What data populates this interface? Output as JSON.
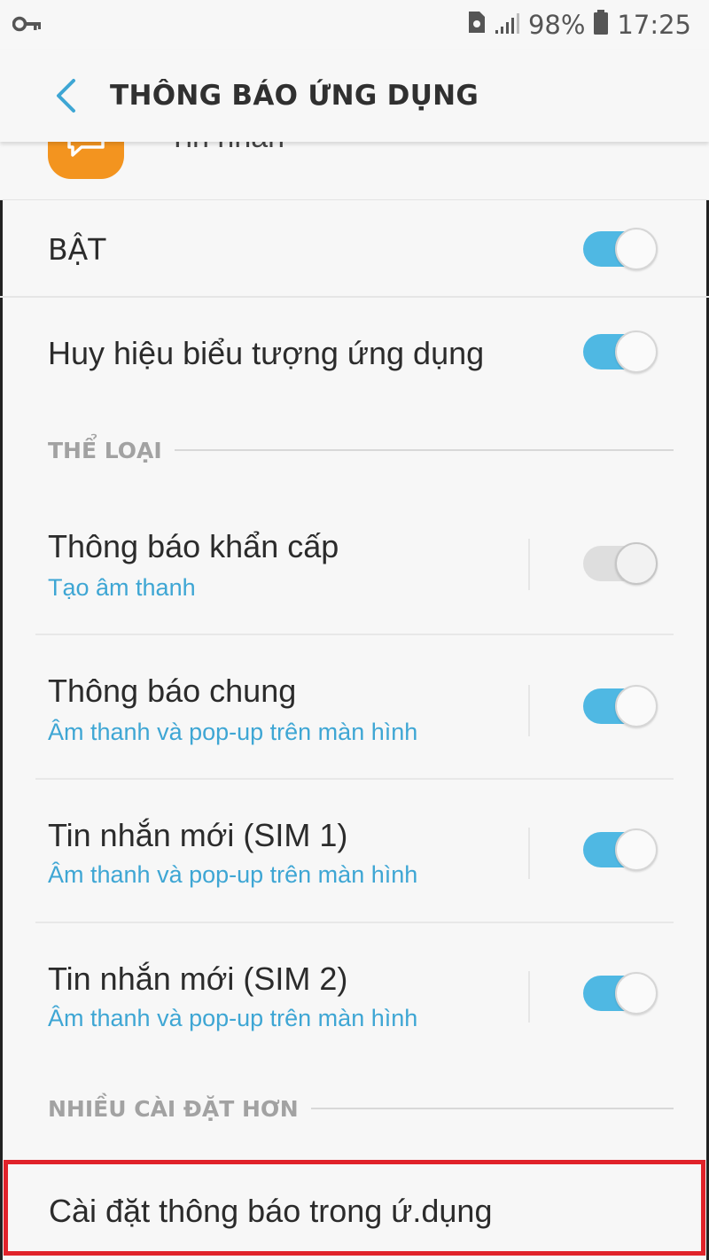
{
  "status_bar": {
    "battery": "98%",
    "time": "17:25",
    "icons": [
      "key-icon",
      "sim-icon",
      "signal-icon",
      "battery-icon"
    ]
  },
  "app_bar": {
    "title": "THÔNG BÁO ỨNG DỤNG",
    "back_icon": "chevron-left-icon"
  },
  "app_header": {
    "name": "Tin nhắn",
    "icon": "messages-app-icon",
    "icon_color": "#f3941f"
  },
  "main_toggles": [
    {
      "label": "BẬT",
      "on": true
    },
    {
      "label": "Huy hiệu biểu tượng ứng dụng",
      "on": true
    }
  ],
  "sections": {
    "categories": "THỂ LOẠI",
    "more_settings": "NHIỀU CÀI ĐẶT HƠN"
  },
  "categories": [
    {
      "title": "Thông báo khẩn cấp",
      "subtitle": "Tạo âm thanh",
      "on": true,
      "enabled": false
    },
    {
      "title": "Thông báo chung",
      "subtitle": "Âm thanh và pop-up trên màn hình",
      "on": true,
      "enabled": true
    },
    {
      "title": "Tin nhắn mới (SIM 1)",
      "subtitle": "Âm thanh và pop-up trên màn hình",
      "on": true,
      "enabled": true
    },
    {
      "title": "Tin nhắn mới (SIM 2)",
      "subtitle": "Âm thanh và pop-up trên màn hình",
      "on": true,
      "enabled": true
    }
  ],
  "in_app_settings": {
    "label": "Cài đặt thông báo trong ứ.dụng",
    "highlight_color": "#e0222a"
  },
  "colors": {
    "accent": "#4fb8e3",
    "subtitle": "#3ea6d4",
    "section_header": "#a2a2a2"
  }
}
